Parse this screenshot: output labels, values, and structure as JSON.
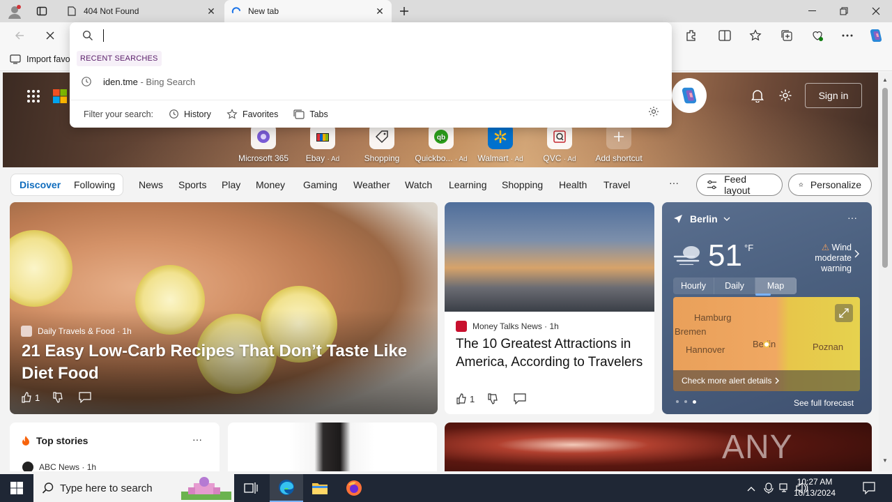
{
  "browser": {
    "tabs": [
      {
        "title": "404 Not Found",
        "active": false
      },
      {
        "title": "New tab",
        "active": true
      }
    ],
    "favorites_bar": {
      "import_label": "Import favo"
    }
  },
  "omnibox": {
    "input_value": "",
    "recent_label": "RECENT SEARCHES",
    "recent_items": [
      {
        "primary": "iden.tme",
        "secondary": " - Bing Search"
      }
    ],
    "filter_label": "Filter your search:",
    "filters": [
      "History",
      "Favorites",
      "Tabs"
    ]
  },
  "header": {
    "sign_in": "Sign in"
  },
  "shortcuts": [
    {
      "label": "Microsoft 365",
      "ad": ""
    },
    {
      "label": "Ebay",
      "ad": "· Ad"
    },
    {
      "label": "Shopping",
      "ad": ""
    },
    {
      "label": "Quickbo...",
      "ad": "· Ad"
    },
    {
      "label": "Walmart",
      "ad": "· Ad"
    },
    {
      "label": "QVC",
      "ad": "· Ad"
    },
    {
      "label": "Add shortcut",
      "ad": ""
    }
  ],
  "nav": {
    "pill_items": [
      "Discover",
      "Following"
    ],
    "items": [
      "News",
      "Sports",
      "Play",
      "Money",
      "Gaming",
      "Weather",
      "Watch",
      "Learning",
      "Shopping",
      "Health",
      "Travel"
    ],
    "more": "···",
    "feed_layout": "Feed layout",
    "personalize": "Personalize"
  },
  "cards": {
    "main": {
      "source": "Daily Travels & Food",
      "age": "· 1h",
      "title": "21 Easy Low-Carb Recipes That Don’t Taste Like Diet Food",
      "likes": "1"
    },
    "mid": {
      "source": "Money Talks News",
      "age": "· 1h",
      "title": "The 10 Greatest Attractions in America, According to Travelers",
      "likes": "1"
    },
    "top_stories": {
      "title": "Top stories",
      "source": "ABC News",
      "age": "· 1h"
    }
  },
  "weather": {
    "city": "Berlin",
    "temp": "51",
    "unit": "°F",
    "alert_title": "Wind",
    "alert_sub": "moderate warning",
    "tabs": [
      "Hourly",
      "Daily",
      "Map"
    ],
    "active_tab": "Map",
    "map_labels": [
      "Hamburg",
      "Bremen",
      "Hannover",
      "Berlin",
      "Poznan"
    ],
    "alert_link": "Check more alert details",
    "forecast_link": "See full forecast"
  },
  "watermark": "ANY RUN",
  "taskbar": {
    "search_placeholder": "Type here to search",
    "time": "10:27 AM",
    "date": "10/13/2024"
  }
}
